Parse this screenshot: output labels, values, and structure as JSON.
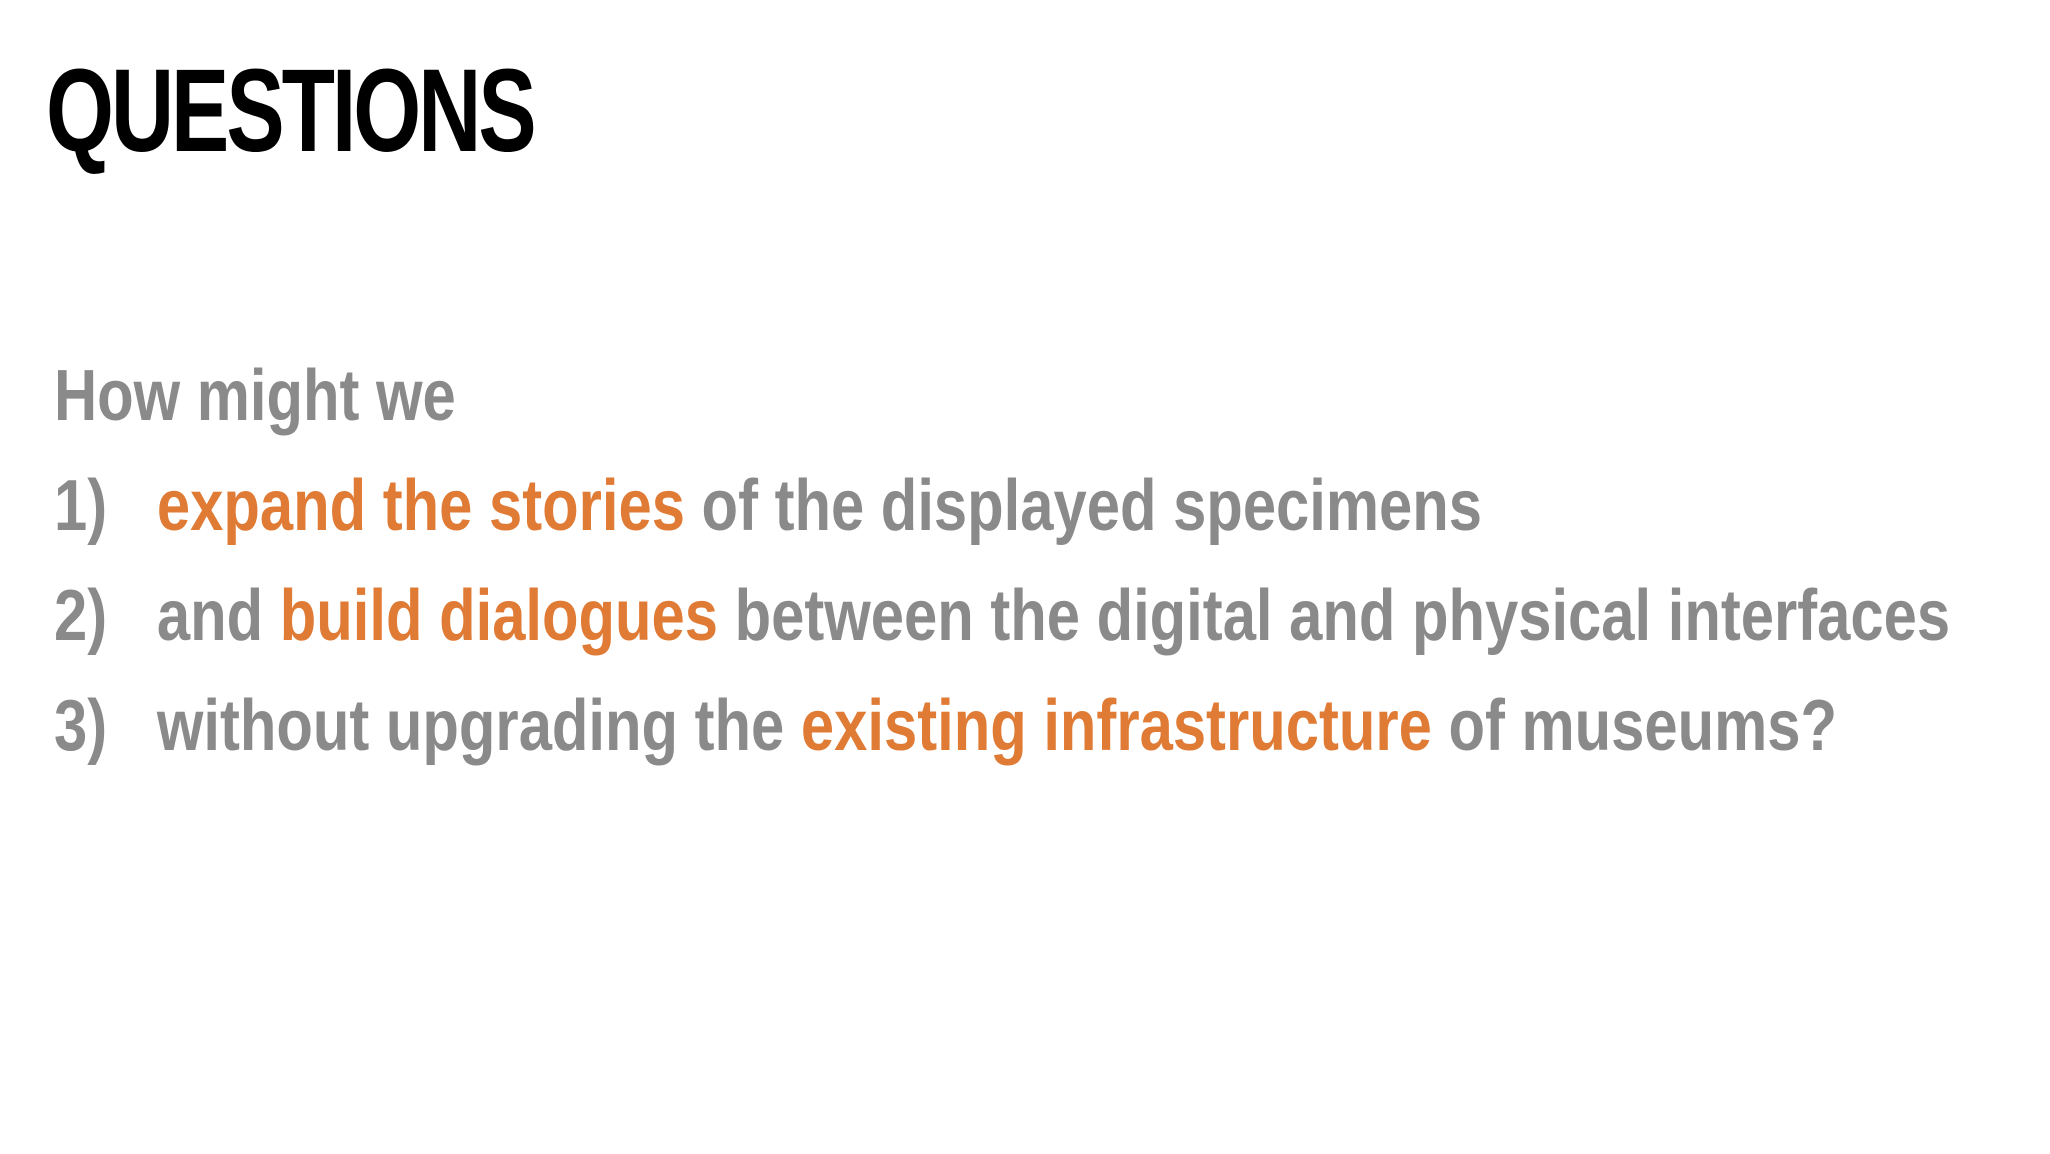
{
  "slide": {
    "title": "QUESTIONS",
    "intro": "How might we",
    "colors": {
      "body_text": "#8a8a8a",
      "highlight": "#e07b35",
      "title": "#000000"
    },
    "questions": [
      {
        "number": "1)",
        "parts": [
          "",
          "expand the stories",
          " of the displayed specimens"
        ]
      },
      {
        "number": "2)",
        "parts": [
          "and ",
          "build dialogues",
          " between the digital and physical interfaces"
        ]
      },
      {
        "number": "3)",
        "parts": [
          "without upgrading the ",
          "existing infrastructure",
          " of museums?"
        ]
      }
    ]
  }
}
